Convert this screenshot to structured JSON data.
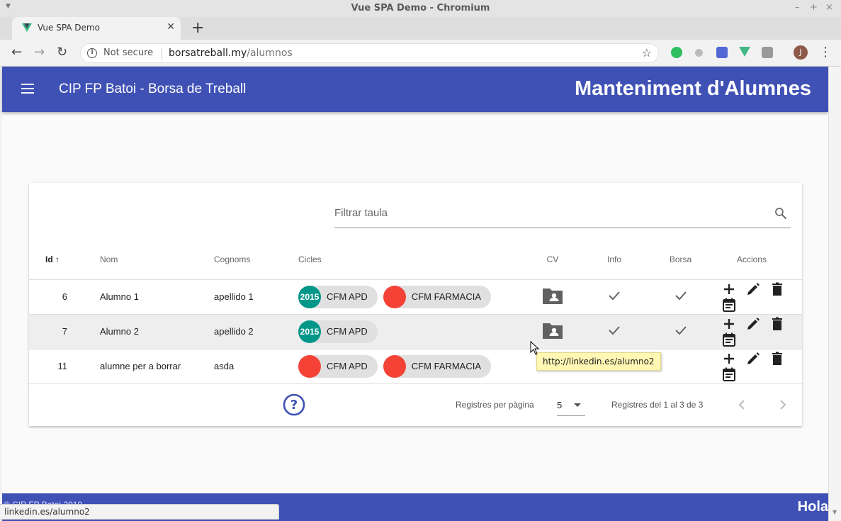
{
  "window": {
    "title": "Vue SPA Demo - Chromium"
  },
  "tab": {
    "title": "Vue SPA Demo"
  },
  "omnibox": {
    "security": "Not secure",
    "host": "borsatreball.my",
    "path": "/alumnos"
  },
  "browser_profile_initial": "J",
  "app": {
    "title": "CIP FP Batoi - Borsa de Treball",
    "heading": "Manteniment d'Alumnes",
    "primary_color": "#3f51b5"
  },
  "search": {
    "placeholder": "Filtrar taula"
  },
  "table": {
    "headers": {
      "id": "Id",
      "nom": "Nom",
      "cognoms": "Cognoms",
      "cicles": "Cicles",
      "cv": "CV",
      "info": "Info",
      "borsa": "Borsa",
      "accions": "Accions"
    },
    "sort": {
      "column": "Id",
      "direction": "ascending"
    },
    "rows": [
      {
        "id": "6",
        "nom": "Alumno 1",
        "cognoms": "apellido 1",
        "cicles": [
          {
            "badge": "2015",
            "label": "CFM APD",
            "color": "#009688"
          },
          {
            "badge": "",
            "label": "CFM FARMACIA",
            "color": "#f44336"
          }
        ],
        "cv": true,
        "info": true,
        "borsa": true
      },
      {
        "id": "7",
        "nom": "Alumno 2",
        "cognoms": "apellido 2",
        "cicles": [
          {
            "badge": "2015",
            "label": "CFM APD",
            "color": "#009688"
          }
        ],
        "cv": true,
        "info": true,
        "borsa": true
      },
      {
        "id": "11",
        "nom": "alumne per a borrar",
        "cognoms": "asda",
        "cicles": [
          {
            "badge": "",
            "label": "CFM APD",
            "color": "#f44336"
          },
          {
            "badge": "",
            "label": "CFM FARMACIA",
            "color": "#f44336"
          }
        ],
        "cv": false,
        "info": false,
        "borsa": false
      }
    ]
  },
  "pagination": {
    "rows_per_page_label": "Registres per pàgina",
    "rows_per_page": "5",
    "range": "Registres del 1 al 3 de 3"
  },
  "tooltip": "http://linkedin.es/alumno2",
  "footer": {
    "copyright": "© CIP FP Batoi 2019",
    "greeting": "Hola"
  },
  "status_bar": "linkedin.es/alumno2"
}
